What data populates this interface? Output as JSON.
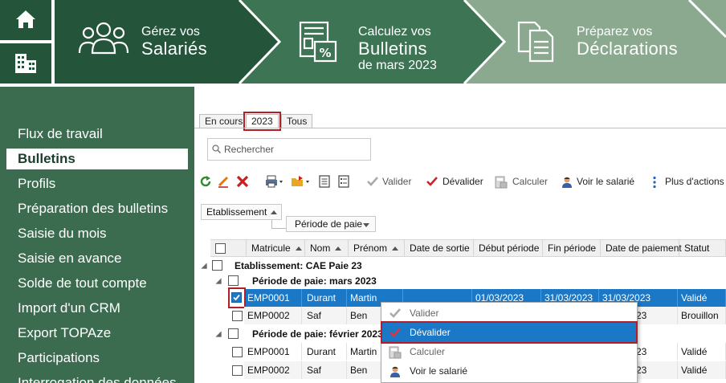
{
  "header": {
    "steps": [
      {
        "line1": "Gérez vos",
        "line2": "Salariés",
        "line3": ""
      },
      {
        "line1": "Calculez vos",
        "line2": "Bulletins",
        "line3": "de mars 2023"
      },
      {
        "line1": "Préparez vos",
        "line2": "Déclarations",
        "line3": ""
      }
    ]
  },
  "sidebar": {
    "items": [
      "Flux de travail",
      "Bulletins",
      "Profils",
      "Préparation des bulletins",
      "Saisie du mois",
      "Saisie en avance",
      "Solde de tout compte",
      "Import d'un CRM",
      "Export TOPAze",
      "Participations",
      "Interrogation des données"
    ],
    "active": "Bulletins"
  },
  "tabs": [
    "En cours",
    "2023",
    "Tous"
  ],
  "search": {
    "placeholder": "Rechercher"
  },
  "toolbar": {
    "valider": "Valider",
    "devalider": "Dévalider",
    "calculer": "Calculer",
    "voir_salarie": "Voir le salarié",
    "plus_actions": "Plus d'actions"
  },
  "grouping": {
    "level1": "Etablissement",
    "level2": "Période de paie"
  },
  "grid": {
    "columns": [
      "Matricule",
      "Nom",
      "Prénom",
      "Date de sortie",
      "Début période",
      "Fin période",
      "Date de paiement",
      "Statut"
    ],
    "group1": "Etablissement: CAE Paie 23",
    "periods": [
      {
        "label": "Période de paie: mars 2023",
        "rows": [
          {
            "matricule": "EMP0001",
            "nom": "Durant",
            "prenom": "Martin",
            "sortie": "",
            "debut": "01/03/2023",
            "fin": "31/03/2023",
            "paiement": "31/03/2023",
            "statut": "Validé"
          },
          {
            "matricule": "EMP0002",
            "nom": "Saf",
            "prenom": "Ben",
            "sortie": "",
            "debut": "",
            "fin": "",
            "paiement": "23",
            "statut": "Brouillon"
          }
        ]
      },
      {
        "label": "Période de paie: février 2023",
        "rows": [
          {
            "matricule": "EMP0001",
            "nom": "Durant",
            "prenom": "Martin",
            "sortie": "",
            "debut": "",
            "fin": "",
            "paiement": "23",
            "statut": "Validé"
          },
          {
            "matricule": "EMP0002",
            "nom": "Saf",
            "prenom": "Ben",
            "sortie": "",
            "debut": "",
            "fin": "",
            "paiement": "23",
            "statut": "Validé"
          }
        ]
      }
    ]
  },
  "context_menu": {
    "items": [
      "Valider",
      "Dévalider",
      "Calculer",
      "Voir le salarié"
    ],
    "highlighted": "Dévalider"
  },
  "colors": {
    "banner_dark": "#24543a",
    "banner_mid": "#3d7454",
    "banner_light": "#8aa98e",
    "sidebar": "#3c6c50",
    "selection": "#1a78c7",
    "highlight_border": "#b41e26"
  }
}
